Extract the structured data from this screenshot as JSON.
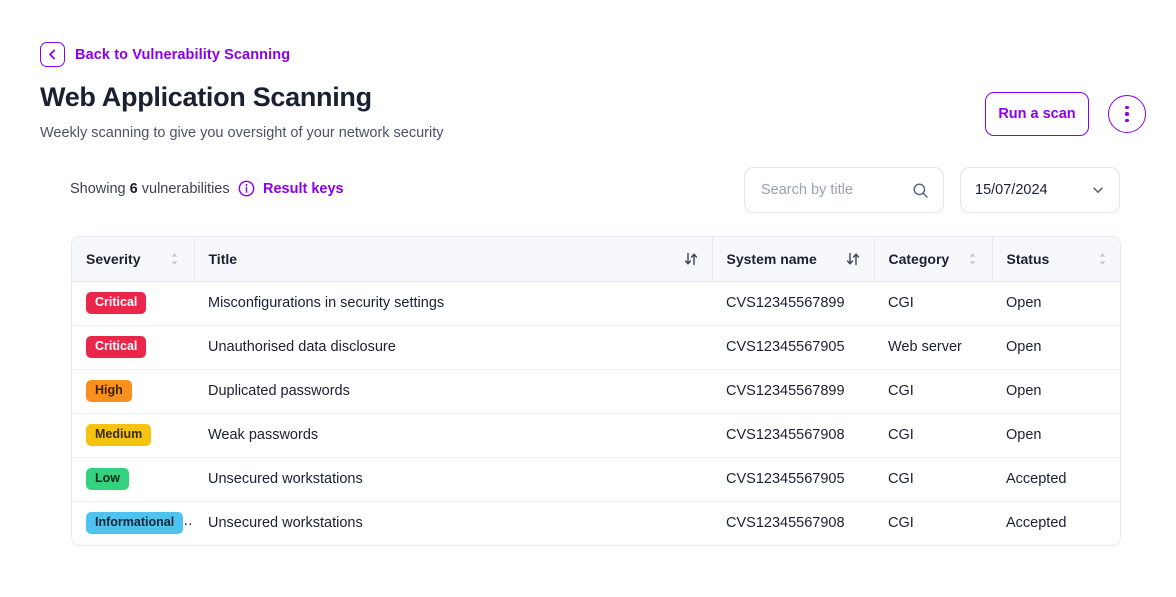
{
  "back": {
    "label": "Back to Vulnerability Scanning",
    "icon": "chevron-left-icon"
  },
  "header": {
    "title": "Web Application Scanning",
    "subtitle": "Weekly scanning to give you oversight of your network security",
    "run_scan_label": "Run a scan",
    "more_menu_icon": "vertical-dots-icon"
  },
  "filters": {
    "showing_prefix": "Showing",
    "showing_count": "6",
    "showing_suffix": "vulnerabilities",
    "result_keys_label": "Result keys",
    "info_icon": "info-circle-icon",
    "search_placeholder": "Search by title",
    "search_value": "",
    "search_icon": "search-icon",
    "date_value": "15/07/2024",
    "date_icon": "chevron-down-icon"
  },
  "table": {
    "columns": [
      {
        "label": "Severity",
        "sort": "both"
      },
      {
        "label": "Title",
        "sort": "active"
      },
      {
        "label": "System name",
        "sort": "active"
      },
      {
        "label": "Category",
        "sort": "both"
      },
      {
        "label": "Status",
        "sort": "both"
      }
    ],
    "rows": [
      {
        "severity": "Critical",
        "title": "Misconfigurations in security settings",
        "system": "CVS12345567899",
        "category": "CGI",
        "status": "Open"
      },
      {
        "severity": "Critical",
        "title": "Unauthorised data disclosure",
        "system": "CVS12345567905",
        "category": "Web server",
        "status": "Open"
      },
      {
        "severity": "High",
        "title": "Duplicated passwords",
        "system": "CVS12345567899",
        "category": "CGI",
        "status": "Open"
      },
      {
        "severity": "Medium",
        "title": "Weak passwords",
        "system": "CVS12345567908",
        "category": "CGI",
        "status": "Open"
      },
      {
        "severity": "Low",
        "title": "Unsecured workstations",
        "system": "CVS12345567905",
        "category": "CGI",
        "status": "Accepted"
      },
      {
        "severity": "Informational",
        "title": "Unsecured workstations",
        "system": "CVS12345567908",
        "category": "CGI",
        "status": "Accepted"
      }
    ]
  },
  "colors": {
    "accent_purple": "#8B00F0",
    "severity_critical_bg": "#E8274B",
    "severity_critical_fg": "#ffffff",
    "severity_high_bg": "#F7901E",
    "severity_high_fg": "#3a2400",
    "severity_medium_bg": "#F5C211",
    "severity_medium_fg": "#3a2e00",
    "severity_low_bg": "#34D17E",
    "severity_low_fg": "#0d2b1a",
    "severity_informational_bg": "#4FC3F0",
    "severity_informational_fg": "#0b2836"
  }
}
